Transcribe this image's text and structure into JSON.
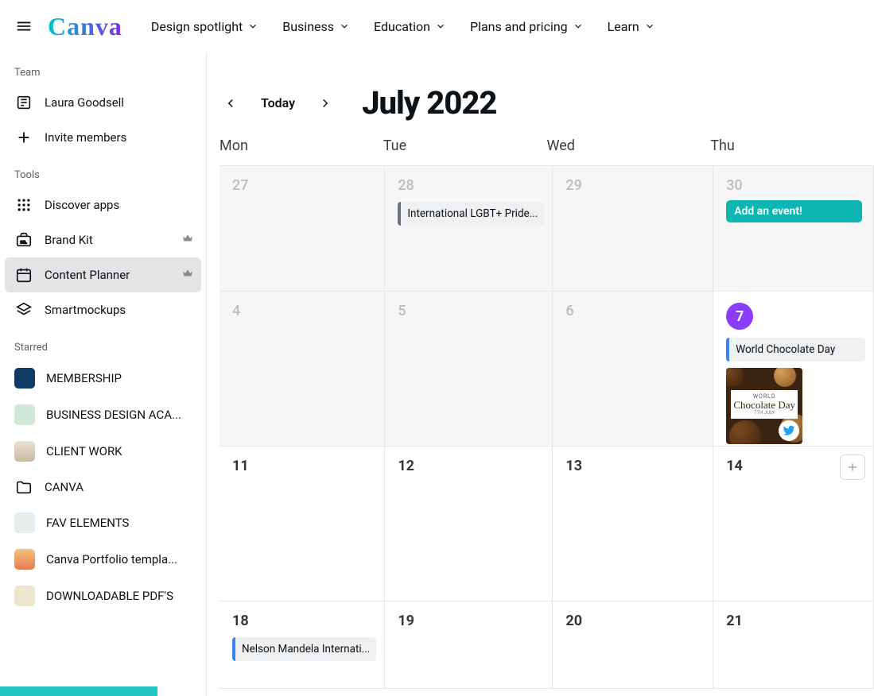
{
  "brand": "Canva",
  "topnav": {
    "items": [
      {
        "label": "Design spotlight"
      },
      {
        "label": "Business"
      },
      {
        "label": "Education"
      },
      {
        "label": "Plans and pricing"
      },
      {
        "label": "Learn"
      }
    ]
  },
  "sidebar": {
    "sections": {
      "team": {
        "label": "Team"
      },
      "tools": {
        "label": "Tools"
      },
      "starred": {
        "label": "Starred"
      }
    },
    "team_member": "Laura Goodsell",
    "invite": "Invite members",
    "tools": [
      {
        "label": "Discover apps"
      },
      {
        "label": "Brand Kit",
        "premium": true
      },
      {
        "label": "Content Planner",
        "premium": true,
        "active": true
      },
      {
        "label": "Smartmockups"
      }
    ],
    "starred": [
      {
        "label": "MEMBERSHIP",
        "thumb_bg": "#0e3b66"
      },
      {
        "label": "BUSINESS DESIGN ACA...",
        "thumb_bg": "#cfe8d8"
      },
      {
        "label": "CLIENT WORK",
        "thumb_bg": "#e9e0d6"
      },
      {
        "label": "CANVA",
        "thumb_bg": "transparent",
        "is_folder": true
      },
      {
        "label": "FAV ELEMENTS",
        "thumb_bg": "#e7eee9"
      },
      {
        "label": "Canva Portfolio templa...",
        "thumb_bg": "#f3c27a"
      },
      {
        "label": "DOWNLOADABLE PDF'S",
        "thumb_bg": "#efe6d0"
      }
    ]
  },
  "calendar": {
    "today_label": "Today",
    "month_title": "July 2022",
    "day_headers": [
      "Mon",
      "Tue",
      "Wed",
      "Thu"
    ],
    "add_event_label": "Add an event!",
    "cells": [
      {
        "day": "27",
        "past": true
      },
      {
        "day": "28",
        "past": true,
        "event": {
          "text": "International LGBT+ Pride...",
          "color": "gray"
        }
      },
      {
        "day": "29",
        "past": true
      },
      {
        "day": "30",
        "past": true,
        "add_event": true
      },
      {
        "day": "4",
        "past": true
      },
      {
        "day": "5",
        "past": true
      },
      {
        "day": "6",
        "past": true
      },
      {
        "day": "7",
        "today": true,
        "event": {
          "text": "World Chocolate Day",
          "color": "blue"
        },
        "post": {
          "t1": "WORLD",
          "t2": "Chocolate Day",
          "t3": "7TH JULY",
          "network": "twitter"
        }
      },
      {
        "day": "11"
      },
      {
        "day": "12"
      },
      {
        "day": "13"
      },
      {
        "day": "14",
        "show_plus": true
      },
      {
        "day": "18",
        "event": {
          "text": "Nelson Mandela Internati...",
          "color": "blue"
        }
      },
      {
        "day": "19"
      },
      {
        "day": "20"
      },
      {
        "day": "21"
      }
    ]
  },
  "colors": {
    "accent_purple": "#8b3dff",
    "accent_teal": "#0cb7b3"
  }
}
